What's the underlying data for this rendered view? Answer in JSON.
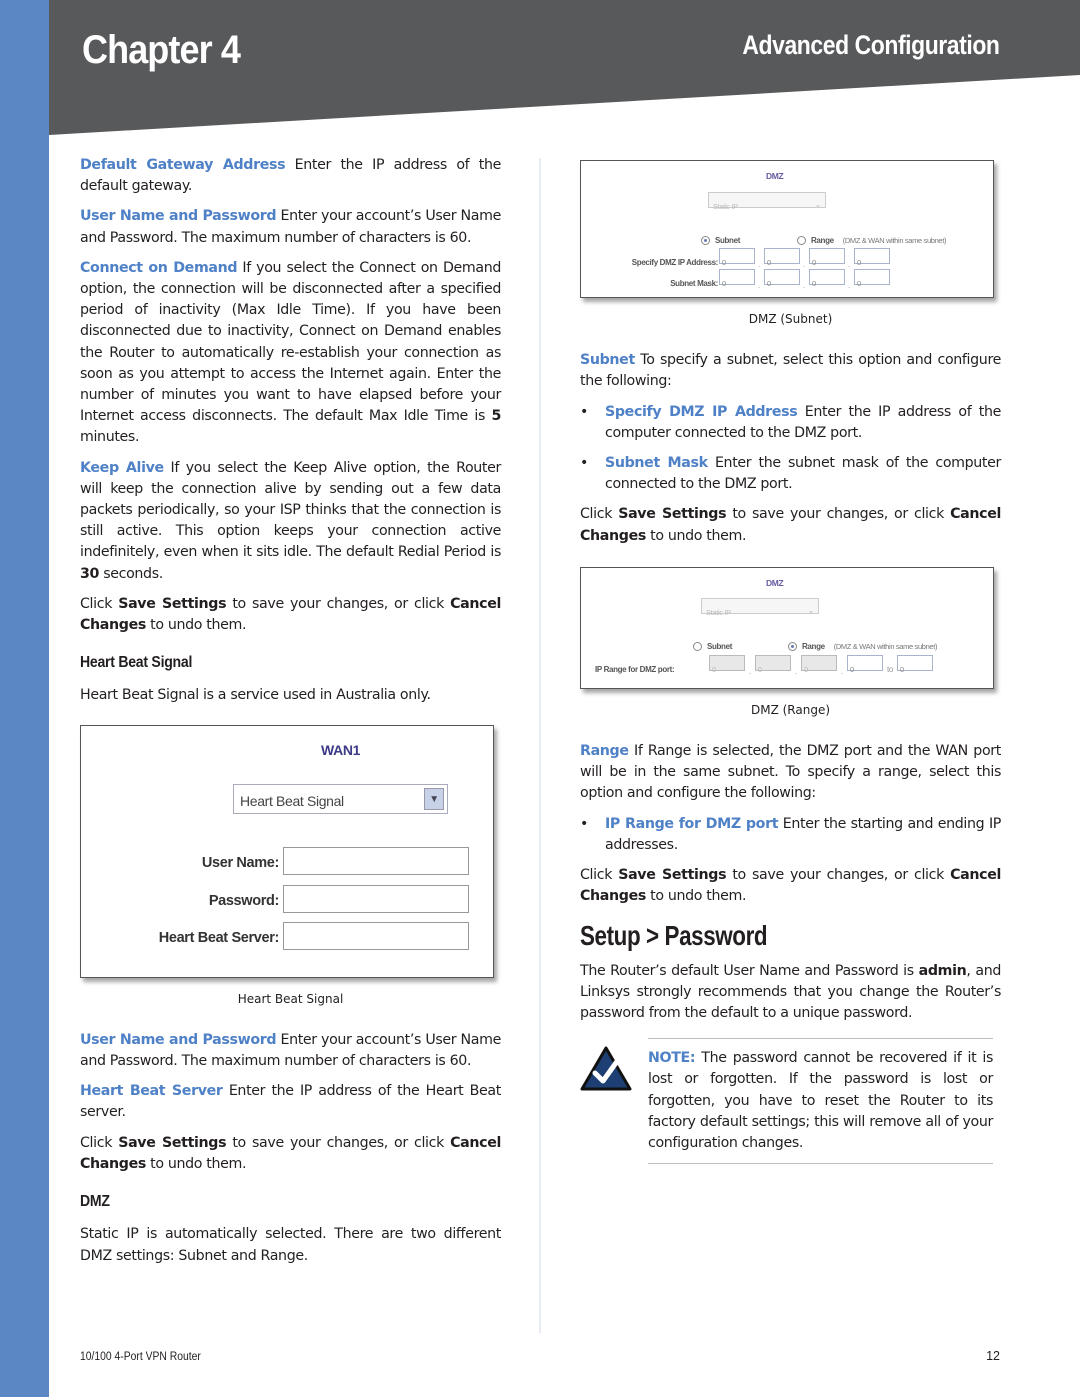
{
  "header": {
    "chapter": "Chapter 4",
    "section": "Advanced Configuration",
    "colors": {
      "band": "#58595b",
      "accent_bar": "#5b87c5",
      "term": "#4f81c7"
    }
  },
  "left": {
    "p1": {
      "term": "Default Gateway Address",
      "text": " Enter the IP address of the default gateway."
    },
    "p2": {
      "term": "User Name and Password",
      "text": " Enter your account’s User Name and Password. The maximum number of characters is 60."
    },
    "p3": {
      "term": "Connect on Demand",
      "text_a": " If you select the Connect on Demand option, the connection will be disconnected after a specified period of inactivity (Max Idle Time). If you have been disconnected due to inactivity, Connect on Demand enables the Router to automatically re-establish your connection as soon as you attempt to access the Internet again. Enter the number of minutes you want to have elapsed before your Internet access disconnects. The default Max Idle Time is ",
      "bold": "5",
      "text_b": " minutes."
    },
    "p4": {
      "term": "Keep Alive",
      "text_a": "  If you select the Keep Alive option, the Router will keep the connection alive by sending out a few data packets periodically, so your ISP thinks that the connection is still active. This option keeps your connection active indefinitely, even when it sits idle. The default Redial Period is ",
      "bold": "30",
      "text_b": " seconds."
    },
    "save1": {
      "a": "Click ",
      "b1": "Save Settings",
      "c": " to save your changes, or click ",
      "b2": "Cancel Changes",
      "d": " to undo them."
    },
    "heading_hbs": "Heart Beat Signal",
    "hbs_intro": "Heart Beat Signal is a service used in Australia only.",
    "wan_figure": {
      "title": "WAN1",
      "select_value": "Heart Beat Signal",
      "fields": [
        {
          "label": "User Name:",
          "value": ""
        },
        {
          "label": "Password:",
          "value": ""
        },
        {
          "label": "Heart Beat Server:",
          "value": ""
        }
      ],
      "caption": "Heart Beat Signal"
    },
    "p5": {
      "term": "User Name and Password",
      "text": " Enter your account’s User Name and Password. The maximum number of characters is 60."
    },
    "p6": {
      "term": "Heart Beat Server",
      "text": "  Enter the IP address of the Heart Beat server."
    },
    "save2": {
      "a": "Click ",
      "b1": "Save Settings",
      "c": " to save your changes, or click ",
      "b2": "Cancel Changes",
      "d": " to undo them."
    },
    "heading_dmz": "DMZ",
    "dmz_intro": "Static IP is automatically selected. There are two different DMZ settings: Subnet and Range."
  },
  "right": {
    "dmz_subnet_figure": {
      "title": "DMZ",
      "select_value": "Static IP",
      "radio_subnet": "Subnet",
      "radio_range": "Range",
      "range_note": "(DMZ & WAN within same subnet)",
      "selected": "Subnet",
      "ip_label": "Specify DMZ IP Address:",
      "ip_values": [
        "0",
        "0",
        "0",
        "0"
      ],
      "mask_label": "Subnet Mask:",
      "mask_values": [
        "0",
        "0",
        "0",
        "0"
      ],
      "caption": "DMZ (Subnet)"
    },
    "subnet_p": {
      "term": "Subnet",
      "text": " To specify a subnet, select this option and configure the following:"
    },
    "bullets_subnet": [
      {
        "term": "Specify DMZ IP Address",
        "text": "  Enter the IP address of the computer connected to the DMZ port."
      },
      {
        "term": "Subnet Mask",
        "text": "  Enter the subnet mask of the computer connected to the DMZ port."
      }
    ],
    "save3": {
      "a": "Click ",
      "b1": "Save Settings",
      "c": " to save your changes, or click ",
      "b2": "Cancel Changes",
      "d": " to undo them."
    },
    "dmz_range_figure": {
      "title": "DMZ",
      "select_value": "Static IP",
      "radio_subnet": "Subnet",
      "radio_range": "Range",
      "range_note": "(DMZ & WAN within same subnet)",
      "selected": "Range",
      "ip_label": "IP Range for DMZ port:",
      "ip_values": [
        "0",
        "0",
        "0",
        "0"
      ],
      "to_label": "to",
      "to_value": "0",
      "caption": "DMZ (Range)"
    },
    "range_p": {
      "term": "Range",
      "text": "  If Range is selected, the DMZ port and the WAN port will be in the same subnet. To specify a range, select this option and configure the following:"
    },
    "bullets_range": [
      {
        "term": "IP Range for DMZ port",
        "text": "  Enter the starting and ending IP addresses."
      }
    ],
    "save4": {
      "a": "Click ",
      "b1": "Save Settings",
      "c": " to save your changes, or click ",
      "b2": "Cancel Changes",
      "d": " to undo them."
    },
    "heading_password": "Setup > Password",
    "password_p": {
      "a": "The Router’s default User Name and Password is ",
      "bold": "admin",
      "b": ", and Linksys strongly recommends that you change the Router’s password from the default to a unique password."
    },
    "note": {
      "label": "NOTE:",
      "text": " The password cannot be recovered if it is lost or forgotten. If the password is lost or forgotten, you have to reset the Router to its factory default settings; this will remove all of your configuration changes."
    }
  },
  "footer": {
    "product": "10/100 4-Port VPN Router",
    "page": "12"
  }
}
